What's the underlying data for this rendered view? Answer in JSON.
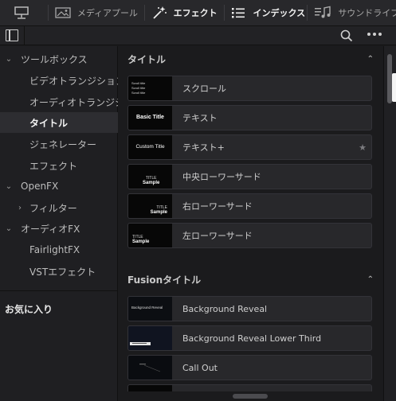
{
  "toolbar": {
    "items": [
      {
        "label": "",
        "icon": "monitor-icon",
        "active": false
      },
      {
        "label": "メディアプール",
        "icon": "media-pool-icon",
        "active": false
      },
      {
        "label": "エフェクト",
        "icon": "effects-wand-icon",
        "active": true
      },
      {
        "label": "インデックス",
        "icon": "index-list-icon",
        "active": true
      },
      {
        "label": "サウンドライブラ",
        "icon": "sound-library-icon",
        "active": false
      }
    ]
  },
  "sidebar": {
    "items": [
      {
        "label": "ツールボックス",
        "indent": 0,
        "chevron": "down"
      },
      {
        "label": "ビデオトランジション",
        "indent": 1
      },
      {
        "label": "オーディオトランジション",
        "indent": 1
      },
      {
        "label": "タイトル",
        "indent": 1,
        "selected": true
      },
      {
        "label": "ジェネレーター",
        "indent": 1
      },
      {
        "label": "エフェクト",
        "indent": 1
      },
      {
        "label": "OpenFX",
        "indent": 0,
        "chevron": "down"
      },
      {
        "label": "フィルター",
        "indent": 1,
        "chevron": "right"
      },
      {
        "label": "オーディオFX",
        "indent": 0,
        "chevron": "down"
      },
      {
        "label": "FairlightFX",
        "indent": 1
      },
      {
        "label": "VSTエフェクト",
        "indent": 1
      }
    ],
    "favorites_label": "お気に入り"
  },
  "sections": [
    {
      "title": "タイトル",
      "items": [
        {
          "label": "スクロール",
          "thumb": "scroll",
          "thumb_text": [
            "Scroll title",
            "Scroll title",
            "Scroll title"
          ]
        },
        {
          "label": "テキスト",
          "thumb": "center",
          "thumb_text": [
            "Basic Title"
          ]
        },
        {
          "label": "テキスト+",
          "thumb": "center",
          "thumb_text": [
            "Custom Title"
          ],
          "favorite_star": true
        },
        {
          "label": "中央ローワーサード",
          "thumb": "lower-center",
          "thumb_text": [
            "TITLE",
            "Sample"
          ]
        },
        {
          "label": "右ローワーサード",
          "thumb": "lower-right",
          "thumb_text": [
            "TITLE",
            "Sample"
          ]
        },
        {
          "label": "左ローワーサード",
          "thumb": "lower-left",
          "thumb_text": [
            "TITLE",
            "Sample"
          ]
        }
      ]
    },
    {
      "title": "Fusionタイトル",
      "items": [
        {
          "label": "Background Reveal",
          "thumb": "bgreveal",
          "thumb_text": [
            "Background Reveal"
          ]
        },
        {
          "label": "Background Reveal Lower Third",
          "thumb": "lowerbar",
          "thumb_text": []
        },
        {
          "label": "Call Out",
          "thumb": "callout",
          "thumb_text": []
        },
        {
          "label": "",
          "thumb": "blank",
          "thumb_text": []
        }
      ]
    }
  ],
  "colors": {
    "background": "#1b1b1d",
    "panel": "#28282b",
    "accent_text": "#f2f2f2"
  }
}
